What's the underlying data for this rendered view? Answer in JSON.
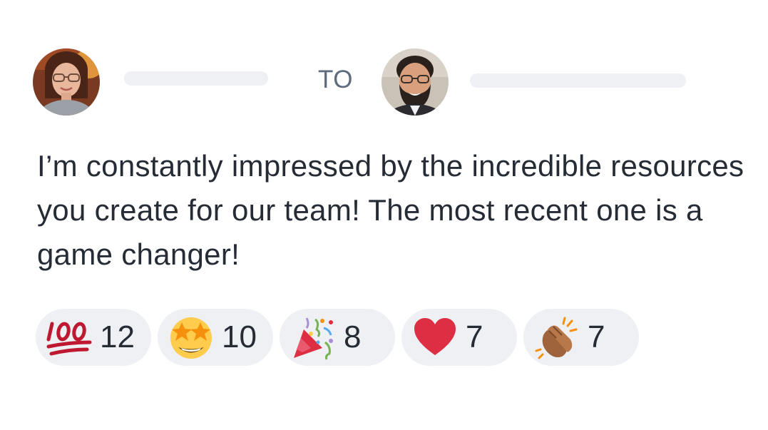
{
  "header": {
    "to_label": "TO",
    "sender_avatar": "sender-avatar",
    "recipient_avatar": "recipient-avatar"
  },
  "message": {
    "text": "I’m constantly impressed by the incredible resources you create for our team! The most recent one is a game changer!"
  },
  "reactions": [
    {
      "icon": "hundred-points-icon",
      "count": "12"
    },
    {
      "icon": "star-struck-icon",
      "count": "10"
    },
    {
      "icon": "party-popper-icon",
      "count": "8"
    },
    {
      "icon": "red-heart-icon",
      "count": "7"
    },
    {
      "icon": "clapping-hands-icon",
      "count": "7"
    }
  ],
  "colors": {
    "text": "#262c35",
    "muted": "#5e6b7c",
    "pill_background": "#eff0f3",
    "placeholder": "#eef0f4"
  }
}
